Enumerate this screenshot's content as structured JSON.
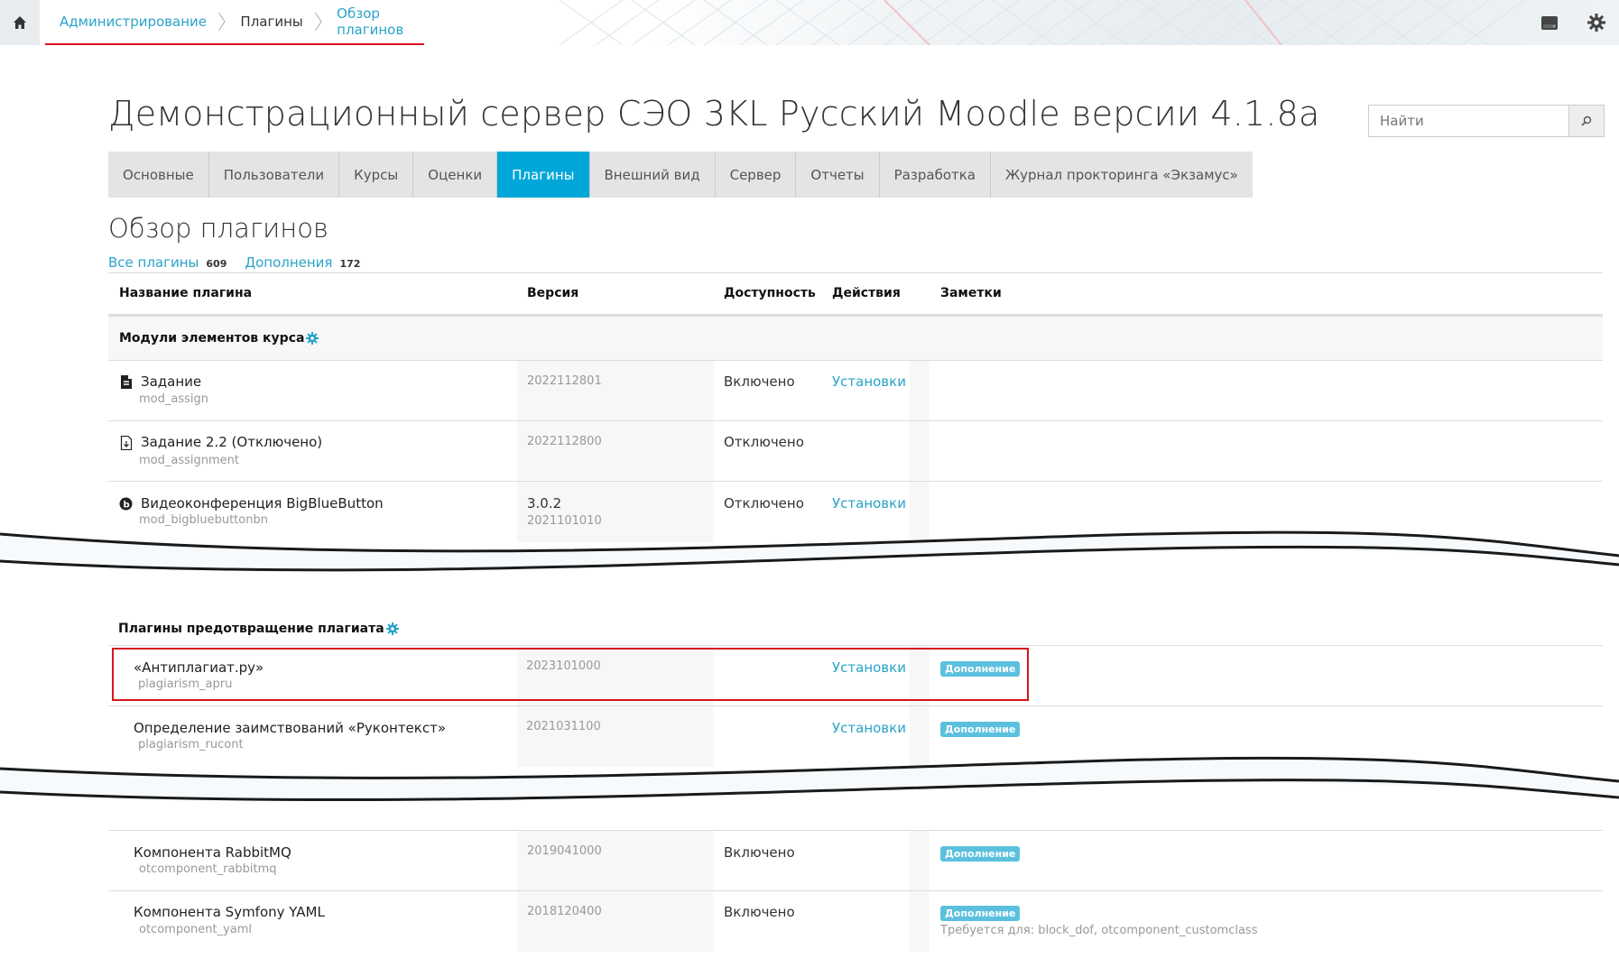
{
  "breadcrumb": [
    {
      "label": "Администрирование"
    },
    {
      "label": "Плагины"
    },
    {
      "label": "Обзор плагинов"
    }
  ],
  "header": {
    "site_title": "Демонстрационный сервер СЭО 3KL Русский Moodle версии 4.1.8a",
    "search_placeholder": "Найти"
  },
  "tabs": [
    {
      "label": "Основные",
      "active": false
    },
    {
      "label": "Пользователи",
      "active": false
    },
    {
      "label": "Курсы",
      "active": false
    },
    {
      "label": "Оценки",
      "active": false
    },
    {
      "label": "Плагины",
      "active": true
    },
    {
      "label": "Внешний вид",
      "active": false
    },
    {
      "label": "Сервер",
      "active": false
    },
    {
      "label": "Отчеты",
      "active": false
    },
    {
      "label": "Разработка",
      "active": false
    },
    {
      "label": "Журнал прокторинга «Экзамус»",
      "active": false
    }
  ],
  "page": {
    "heading": "Обзор плагинов",
    "filter_all": "Все плагины",
    "filter_all_count": "609",
    "filter_addons": "Дополнения",
    "filter_addons_count": "172"
  },
  "table": {
    "columns": [
      "Название плагина",
      "Версия",
      "Доступность",
      "Действия",
      "Заметки"
    ],
    "category_1": "Модули элементов курса",
    "category_2": "Плагины предотвращение плагиата",
    "rows": [
      {
        "name": "Задание",
        "component": "mod_assign",
        "version": "2022112801",
        "availability": "Включено",
        "action": "Установки",
        "icon": "assignment-icon"
      },
      {
        "name": "Задание 2.2 (Отключено)",
        "component": "mod_assignment",
        "version": "2022112800",
        "availability": "Отключено",
        "action": "",
        "icon": "assignment-legacy-icon"
      },
      {
        "name": "Видеоконференция BigBlueButton",
        "component": "mod_bigbluebuttonbn",
        "release": "3.0.2",
        "version": "2021101010",
        "availability": "Отключено",
        "action": "Установки",
        "icon": "bigbluebutton-icon"
      },
      {
        "name": "«Антиплагиат.ру»",
        "component": "plagiarism_apru",
        "version": "2023101000",
        "availability": "",
        "action": "Установки",
        "note_badge": "Дополнение"
      },
      {
        "name": "Определение заимствований «Руконтекст»",
        "component": "plagiarism_rucont",
        "version": "2021031100",
        "availability": "",
        "action": "Установки",
        "note_badge": "Дополнение"
      },
      {
        "name": "Компонента RabbitMQ",
        "component": "otcomponent_rabbitmq",
        "version": "2019041000",
        "availability": "Включено",
        "action": "",
        "note_badge": "Дополнение"
      },
      {
        "name": "Компонента Symfony YAML",
        "component": "otcomponent_yaml",
        "version": "2018120400",
        "availability": "Включено",
        "action": "",
        "note_badge": "Дополнение",
        "note_text": "Требуется для: block_dof, otcomponent_customclass"
      }
    ]
  },
  "colors": {
    "accent": "#00a7d8",
    "link": "#2aa3c9",
    "highlight": "#d6151f",
    "badge": "#5bc0de"
  }
}
